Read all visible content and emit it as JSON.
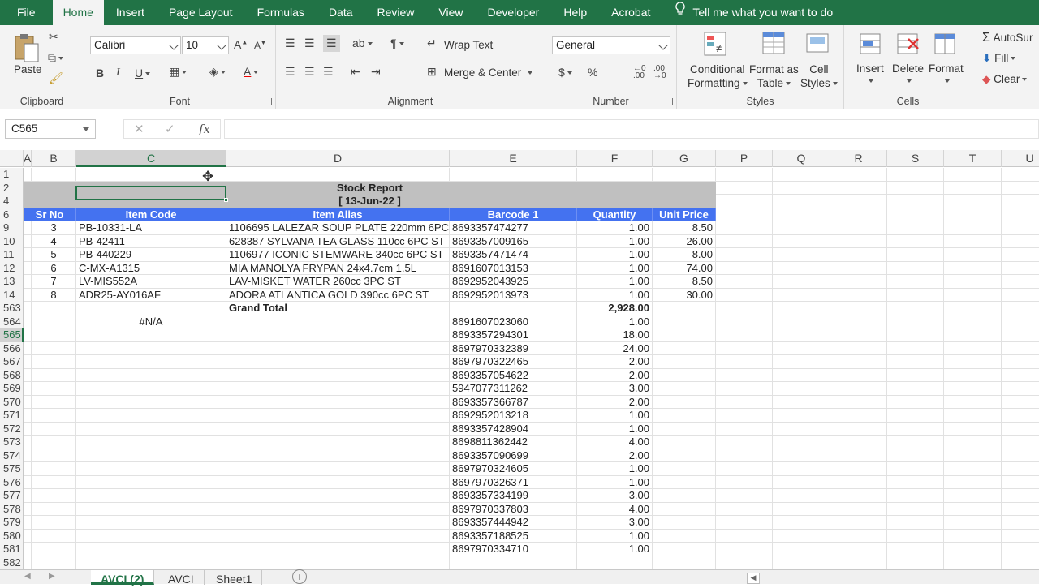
{
  "ribbon_tabs": [
    "File",
    "Home",
    "Insert",
    "Page Layout",
    "Formulas",
    "Data",
    "Review",
    "View",
    "Developer",
    "Help",
    "Acrobat"
  ],
  "active_tab": "Home",
  "tell_me": "Tell me what you want to do",
  "clipboard": {
    "paste": "Paste",
    "label": "Clipboard"
  },
  "font": {
    "name": "Calibri",
    "size": "10",
    "label": "Font",
    "bold": "B",
    "italic": "I",
    "underline": "U"
  },
  "alignment": {
    "wrap": "Wrap Text",
    "merge": "Merge & Center",
    "label": "Alignment"
  },
  "number": {
    "format": "General",
    "currency": "$",
    "percent": "%",
    "label": "Number"
  },
  "styles": {
    "conditional_1": "Conditional",
    "conditional_2": "Formatting",
    "format_as_1": "Format as",
    "format_as_2": "Table",
    "cell_styles_1": "Cell",
    "cell_styles_2": "Styles",
    "label": "Styles"
  },
  "cells": {
    "insert": "Insert",
    "delete": "Delete",
    "format": "Format",
    "label": "Cells"
  },
  "editing": {
    "autosum": "AutoSur",
    "fill": "Fill",
    "clear": "Clear"
  },
  "name_box": "C565",
  "fx": "fx",
  "columns": [
    "A",
    "B",
    "C",
    "D",
    "E",
    "F",
    "G",
    "P",
    "Q",
    "R",
    "S",
    "T",
    "U"
  ],
  "report": {
    "title": "Stock Report",
    "date": "[ 13-Jun-22 ]"
  },
  "headers": {
    "sr": "Sr No",
    "code": "Item Code",
    "alias": "Item Alias",
    "barcode": "Barcode 1",
    "qty": "Quantity",
    "price": "Unit Price"
  },
  "rows": [
    {
      "r": "9",
      "sr": "3",
      "code": "PB-10331-LA",
      "alias": "1106695 LALEZAR SOUP PLATE 220mm 6PC ST",
      "barcode": "8693357474277",
      "qty": "1.00",
      "price": "8.50"
    },
    {
      "r": "10",
      "sr": "4",
      "code": "PB-42411",
      "alias": "628387 SYLVANA TEA GLASS 110cc 6PC ST",
      "barcode": "8693357009165",
      "qty": "1.00",
      "price": "26.00"
    },
    {
      "r": "11",
      "sr": "5",
      "code": "PB-440229",
      "alias": "1106977 ICONIC STEMWARE 340cc 6PC ST",
      "barcode": "8693357471474",
      "qty": "1.00",
      "price": "8.00"
    },
    {
      "r": "12",
      "sr": "6",
      "code": "C-MX-A1315",
      "alias": "MIA MANOLYA FRYPAN 24x4.7cm 1.5L",
      "barcode": "8691607013153",
      "qty": "1.00",
      "price": "74.00"
    },
    {
      "r": "13",
      "sr": "7",
      "code": "LV-MIS552A",
      "alias": "LAV-MISKET WATER 260cc 3PC ST",
      "barcode": "8692952043925",
      "qty": "1.00",
      "price": "8.50"
    },
    {
      "r": "14",
      "sr": "8",
      "code": "ADR25-AY016AF",
      "alias": "ADORA ATLANTICA GOLD 390cc 6PC ST",
      "barcode": "8692952013973",
      "qty": "1.00",
      "price": "30.00"
    }
  ],
  "grand_total": {
    "r": "563",
    "label": "Grand Total",
    "qty": "2,928.00"
  },
  "extra_rows": [
    {
      "r": "564",
      "code": "#N/A",
      "barcode": "8691607023060",
      "qty": "1.00"
    },
    {
      "r": "565",
      "code": "",
      "barcode": "8693357294301",
      "qty": "18.00"
    },
    {
      "r": "566",
      "code": "",
      "barcode": "8697970332389",
      "qty": "24.00"
    },
    {
      "r": "567",
      "code": "",
      "barcode": "8697970322465",
      "qty": "2.00"
    },
    {
      "r": "568",
      "code": "",
      "barcode": "8693357054622",
      "qty": "2.00"
    },
    {
      "r": "569",
      "code": "",
      "barcode": "5947077311262",
      "qty": "3.00"
    },
    {
      "r": "570",
      "code": "",
      "barcode": "8693357366787",
      "qty": "2.00"
    },
    {
      "r": "571",
      "code": "",
      "barcode": "8692952013218",
      "qty": "1.00"
    },
    {
      "r": "572",
      "code": "",
      "barcode": "8693357428904",
      "qty": "1.00"
    },
    {
      "r": "573",
      "code": "",
      "barcode": "8698811362442",
      "qty": "4.00"
    },
    {
      "r": "574",
      "code": "",
      "barcode": "8693357090699",
      "qty": "2.00"
    },
    {
      "r": "575",
      "code": "",
      "barcode": "8697970324605",
      "qty": "1.00"
    },
    {
      "r": "576",
      "code": "",
      "barcode": "8697970326371",
      "qty": "1.00"
    },
    {
      "r": "577",
      "code": "",
      "barcode": "8693357334199",
      "qty": "3.00"
    },
    {
      "r": "578",
      "code": "",
      "barcode": "8697970337803",
      "qty": "4.00"
    },
    {
      "r": "579",
      "code": "",
      "barcode": "8693357444942",
      "qty": "3.00"
    },
    {
      "r": "580",
      "code": "",
      "barcode": "8693357188525",
      "qty": "1.00"
    },
    {
      "r": "581",
      "code": "",
      "barcode": "8697970334710",
      "qty": "1.00"
    },
    {
      "r": "582",
      "code": "",
      "barcode": "",
      "qty": ""
    }
  ],
  "header_rows": [
    "1",
    "2",
    "4",
    "6"
  ],
  "sheet_tabs": [
    "AVCI (2)",
    "AVCI",
    "Sheet1"
  ],
  "active_sheet": "AVCI (2)",
  "colors": {
    "excel_green": "#217346",
    "header_blue": "#4472f0",
    "banner_gray": "#c0c0c0"
  }
}
